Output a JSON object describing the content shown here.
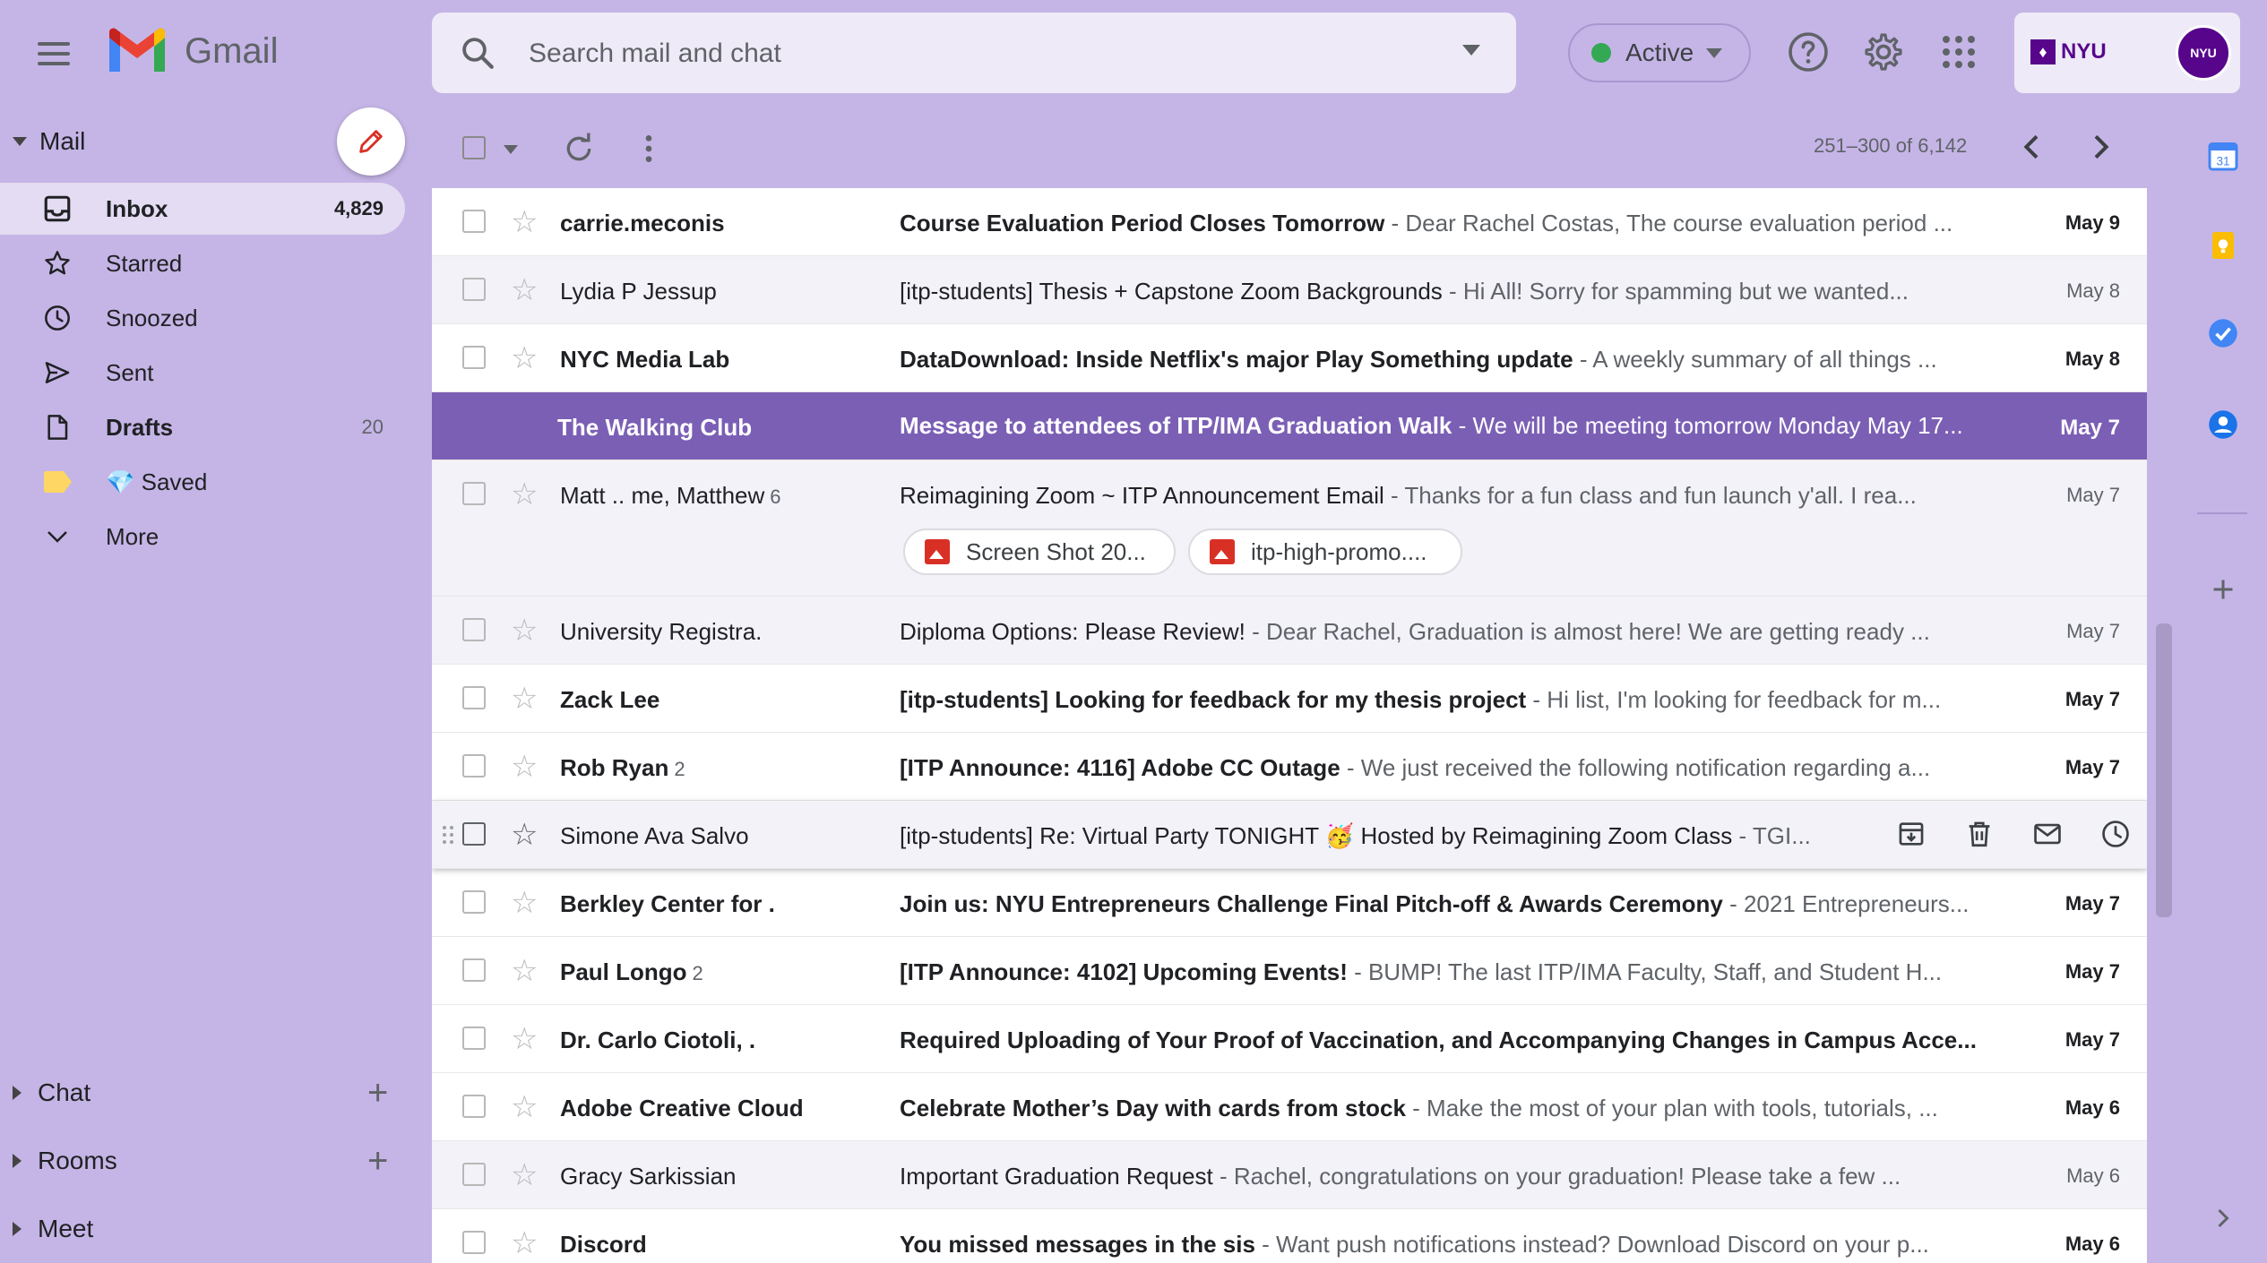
{
  "app": {
    "name": "Gmail"
  },
  "search": {
    "placeholder": "Search mail and chat"
  },
  "status": {
    "label": "Active",
    "color": "#34a853"
  },
  "account": {
    "org_label": "NYU",
    "avatar_text": "NYU"
  },
  "sidebar": {
    "mail_header": "Mail",
    "items": [
      {
        "label": "Inbox",
        "count": "4,829",
        "icon": "inbox-icon",
        "active": true,
        "bold": true
      },
      {
        "label": "Starred",
        "count": "",
        "icon": "star-icon"
      },
      {
        "label": "Snoozed",
        "count": "",
        "icon": "clock-icon"
      },
      {
        "label": "Sent",
        "count": "",
        "icon": "send-icon"
      },
      {
        "label": "Drafts",
        "count": "20",
        "icon": "draft-icon",
        "bold": true
      },
      {
        "label": "💎 Saved",
        "count": "",
        "icon": "label-icon"
      },
      {
        "label": "More",
        "count": "",
        "icon": "chevron-down-icon"
      }
    ],
    "sections": [
      "Chat",
      "Rooms",
      "Meet"
    ]
  },
  "toolbar": {
    "pager": "251–300 of 6,142"
  },
  "emails": [
    {
      "sender": "carrie.meconis",
      "count": "",
      "subject": "Course Evaluation Period Closes Tomorrow",
      "snippet": " - Dear Rachel Costas, The course evaluation period ...",
      "date": "May 9",
      "state": "unread"
    },
    {
      "sender": "Lydia P Jessup",
      "count": "",
      "subject": "[itp-students] Thesis + Capstone Zoom Backgrounds",
      "snippet": " - Hi All! Sorry for spamming but we wanted...",
      "date": "May 8",
      "state": "read"
    },
    {
      "sender": "NYC Media Lab",
      "count": "",
      "subject": "DataDownload: Inside Netflix's major Play Something update",
      "snippet": " - A weekly summary of all things ...",
      "date": "May 8",
      "state": "unread"
    },
    {
      "sender": "The Walking Club",
      "count": "",
      "subject": "Message to attendees of ITP/IMA Graduation Walk",
      "snippet": " - We will be meeting tomorrow Monday May 17...",
      "date": "May 7",
      "state": "selected"
    },
    {
      "sender": "Matt .. me, Matthew",
      "count": "6",
      "subject": "Reimagining Zoom ~ ITP Announcement Email",
      "snippet": " - Thanks for a fun class and fun launch y'all. I rea...",
      "date": "May 7",
      "state": "read",
      "attachments": [
        "Screen Shot 20...",
        "itp-high-promo...."
      ]
    },
    {
      "sender": "University Registra.",
      "count": "",
      "subject": "Diploma Options: Please Review!",
      "snippet": " - Dear Rachel, Graduation is almost here! We are getting ready ...",
      "date": "May 7",
      "state": "read"
    },
    {
      "sender": "Zack Lee",
      "count": "",
      "subject": "[itp-students] Looking for feedback for my thesis project",
      "snippet": " - Hi list, I'm looking for feedback for m...",
      "date": "May 7",
      "state": "unread"
    },
    {
      "sender": "Rob Ryan",
      "count": "2",
      "subject": "[ITP Announce: 4116] Adobe CC Outage",
      "snippet": " - We just received the following notification regarding a...",
      "date": "May 7",
      "state": "unread"
    },
    {
      "sender": "Simone Ava Salvo",
      "count": "",
      "subject": "[itp-students] Re: Virtual Party TONIGHT 🥳  Hosted by Reimagining Zoom Class",
      "snippet": " - TGI...",
      "date": "",
      "state": "hover"
    },
    {
      "sender": "Berkley Center for .",
      "count": "",
      "subject": "Join us: NYU Entrepreneurs Challenge Final Pitch-off & Awards Ceremony",
      "snippet": " - 2021 Entrepreneurs...",
      "date": "May 7",
      "state": "unread"
    },
    {
      "sender": "Paul Longo",
      "count": "2",
      "subject": "[ITP Announce: 4102] Upcoming Events!",
      "snippet": " - BUMP! The last ITP/IMA Faculty, Staff, and Student H...",
      "date": "May 7",
      "state": "unread"
    },
    {
      "sender": "Dr. Carlo Ciotoli, .",
      "count": "",
      "subject": "Required Uploading of Your Proof of Vaccination, and Accompanying Changes in Campus Acce...",
      "snippet": "",
      "date": "May 7",
      "state": "unread"
    },
    {
      "sender": "Adobe Creative Cloud",
      "count": "",
      "subject": "Celebrate Mother’s Day with cards from stock",
      "snippet": " - Make the most of your plan with tools, tutorials, ...",
      "date": "May 6",
      "state": "unread"
    },
    {
      "sender": "Gracy Sarkissian",
      "count": "",
      "subject": "Important Graduation Request",
      "snippet": " - Rachel, congratulations on your graduation! Please take a few ...",
      "date": "May 6",
      "state": "read"
    },
    {
      "sender": "Discord",
      "count": "",
      "subject": "You missed messages in the sis",
      "snippet": " - Want push notifications instead? Download Discord on your p...",
      "date": "May 6",
      "state": "unread"
    }
  ]
}
